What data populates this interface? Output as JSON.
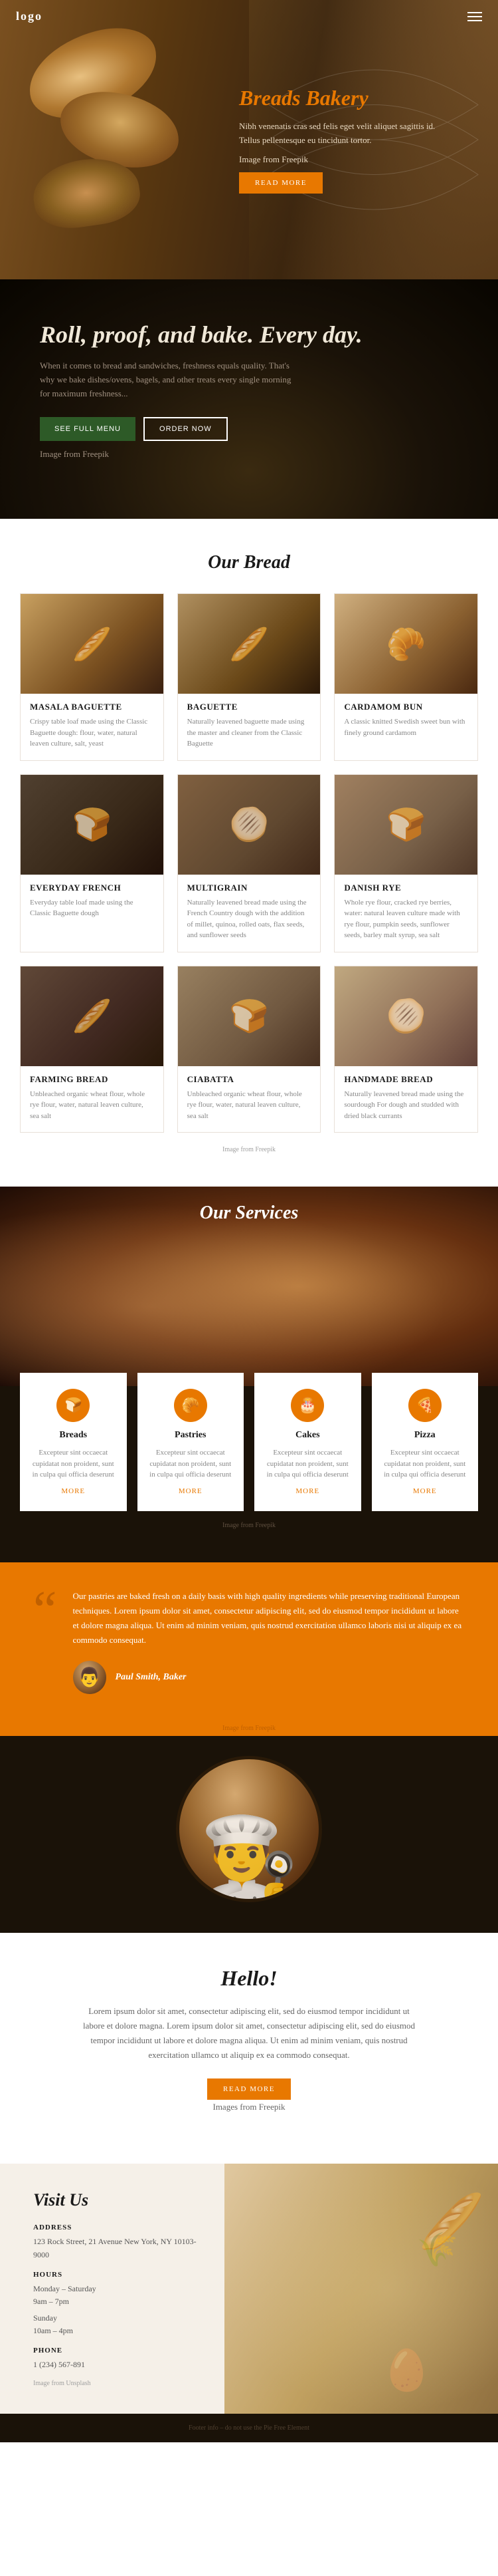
{
  "nav": {
    "logo": "logo",
    "menu_icon": "☰"
  },
  "hero": {
    "title": "Breads Bakery",
    "description": "Nibh venenatis cras sed felis eget velit aliquet sagittis id. Tellus pellentesque eu tincidunt tortor.",
    "image_credit": "Image from Freepik",
    "cta": "READ MORE"
  },
  "roll": {
    "title": "Roll, proof, and bake. Every day.",
    "description": "When it comes to bread and sandwiches, freshness equals quality. That's why we bake dishes/ovens, bagels, and other treats every single morning for maximum freshness...",
    "btn_menu": "SEE FULL MENU",
    "btn_order": "ORDER NOW",
    "image_credit": "Image from Freepik"
  },
  "our_bread": {
    "title": "Our Bread",
    "items": [
      {
        "name": "MASALA BAGUETTE",
        "desc": "Crispy table loaf made using the Classic Baguette dough: flour, water, natural leaven culture, salt, yeast"
      },
      {
        "name": "BAGUETTE",
        "desc": "Naturally leavened baguette made using the master and cleaner from the Classic Baguette"
      },
      {
        "name": "CARDAMOM BUN",
        "desc": "A classic knitted Swedish sweet bun with finely ground cardamom"
      },
      {
        "name": "EVERYDAY FRENCH",
        "desc": "Everyday table loaf made using the Classic Baguette dough"
      },
      {
        "name": "MULTIGRAIN",
        "desc": "Naturally leavened bread made using the French Country dough with the addition of millet, quinoa, rolled oats, flax seeds, and sunflower seeds"
      },
      {
        "name": "DANISH RYE",
        "desc": "Whole rye flour, cracked rye berries, water: natural leaven culture made with rye flour, pumpkin seeds, sunflower seeds, barley malt syrup, sea salt"
      },
      {
        "name": "FARMING BREAD",
        "desc": "Unbleached organic wheat flour, whole rye flour, water, natural leaven culture, sea salt"
      },
      {
        "name": "CIABATTA",
        "desc": "Unbleached organic wheat flour, whole rye flour, water, natural leaven culture, sea salt"
      },
      {
        "name": "HANDMADE BREAD",
        "desc": "Naturally leavened bread made using the sourdough For dough and studded with dried black currants"
      }
    ],
    "image_credit": "Image from Freepik"
  },
  "services": {
    "title": "Our Services",
    "items": [
      {
        "name": "Breads",
        "icon": "🍞",
        "desc": "Excepteur sint occaecat cupidatat non proident, sunt in culpa qui officia deserunt",
        "more": "MORE"
      },
      {
        "name": "Pastries",
        "icon": "🥐",
        "desc": "Excepteur sint occaecat cupidatat non proident, sunt in culpa qui officia deserunt",
        "more": "MORE"
      },
      {
        "name": "Cakes",
        "icon": "🎂",
        "desc": "Excepteur sint occaecat cupidatat non proident, sunt in culpa qui officia deserunt",
        "more": "MORE"
      },
      {
        "name": "Pizza",
        "icon": "🍕",
        "desc": "Excepteur sint occaecat cupidatat non proident, sunt in culpa qui officia deserunt",
        "more": "MORE"
      }
    ],
    "image_credit": "Image from Freepik"
  },
  "quote": {
    "mark": "“",
    "text": "Our pastries are baked fresh on a daily basis with high quality ingredients while preserving traditional European techniques. Lorem ipsum dolor sit amet, consectetur adipiscing elit, sed do eiusmod tempor incididunt ut labore et dolore magna aliqua. Ut enim ad minim veniam, quis nostrud exercitation ullamco laboris nisi ut aliquip ex ea commodo consequat.",
    "author_name": "Paul Smith, Baker",
    "image_credit": "Image from Freepik"
  },
  "hello": {
    "title": "Hello!",
    "text": "Lorem ipsum dolor sit amet, consectetur adipiscing elit, sed do eiusmod tempor incididunt ut labore et dolore magna. Lorem ipsum dolor sit amet, consectetur adipiscing elit, sed do eiusmod tempor incididunt ut labore et dolore magna aliqua. Ut enim ad minim veniam, quis nostrud exercitation ullamco ut aliquip ex ea commodo consequat.",
    "cta": "READ MORE",
    "images_credit": "Images from Freepik"
  },
  "visit": {
    "title": "Visit Us",
    "address_label": "ADDRESS",
    "address": "123 Rock Street, 21 Avenue\nNew York, NY 10103-9000",
    "hours_label": "HOURS",
    "hours_weekday": "Monday – Saturday",
    "hours_weekday_time": "9am – 7pm",
    "hours_sunday": "Sunday",
    "hours_sunday_time": "10am – 4pm",
    "phone_label": "PHONE",
    "phone": "1 (234) 567-891",
    "image_credit": "Image from Unsplash"
  },
  "footer": {
    "text": "Footer info – do not use the Pie Free Element"
  },
  "colors": {
    "accent": "#e87800",
    "dark": "#1a1208",
    "light_bg": "#f5f0e8"
  }
}
